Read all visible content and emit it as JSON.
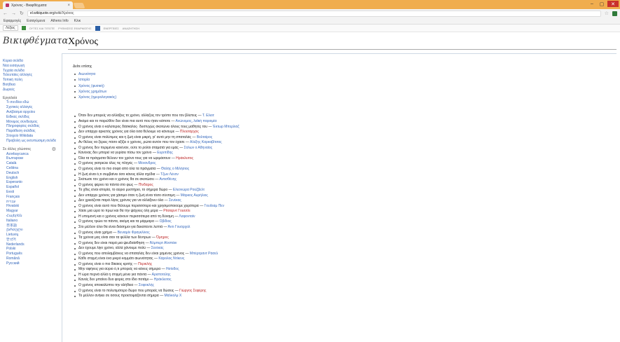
{
  "browser": {
    "tab_title": "Χρόνος - Βικιφθέγματα",
    "tab_close": "×",
    "win_min": "–",
    "win_max": "▢",
    "win_close": "✕",
    "url_host": "el.wikiquote.org",
    "url_path": "/wiki/Χρόνος",
    "bookmarks": [
      "Εφαρμογές",
      "Εισαγόμενα",
      "Athens Info",
      "Κλικ"
    ],
    "toolbar": {
      "button1": "Λέξεις",
      "label1": "ΟΥΤΕΣ ΚΑΙ ΤΙΠΟΤΕ",
      "label2": "ΡΥΘΜΙΣΕΙΣ ΕΦΑΡΜΟΓΗΣ",
      "label3": "ΕΝΕΡΓΕΙΕΣ",
      "label4": "ΑΝΑΖΗΤΗΣΗ"
    }
  },
  "wiki": {
    "logo": "Βικιφθέγματα",
    "page_title": "Χρόνος",
    "sidebar": {
      "nav": [
        "Κύρια σελίδα",
        "Νέα εισαγωγή",
        "Τυχαία σελίδα",
        "Τελευταίες αλλαγές",
        "Τοπική πύλη",
        "Βοήθεια",
        "Δωρεές"
      ],
      "tools_head": "Εργαλεία",
      "tools": [
        "Τι συνδέει εδώ",
        "Σχετικές αλλαγές",
        "Ανέβασμα αρχείου",
        "Ειδικές σελίδες",
        "Μόνιμος σύνδεσμος",
        "Πληροφορίες σελίδας",
        "Παράθεση σελίδας",
        "Στοιχείο Wikidata",
        "Προβολή ως εκτυπώσιμη σελίδα"
      ],
      "lang_head": "Σε άλλες γλώσσες",
      "languages": [
        "Azərbaycanca",
        "Български",
        "Català",
        "Čeština",
        "Deutsch",
        "English",
        "Esperanto",
        "Español",
        "Eesti",
        "Français",
        "עברית",
        "Hrvatski",
        "Magyar",
        "Հայերեն",
        "Italiano",
        "日本語",
        "ქართული",
        "Lietuvių",
        "한국어",
        "Nederlands",
        "Polski",
        "Português",
        "Română",
        "Русский"
      ]
    },
    "see_also": "Δείτε επίσης",
    "links": [
      "Αιωνιότητα",
      "Ιστορία",
      "Χρόνος (φυσική)",
      "Χρόνος χρημάτων",
      "Χρόνος (ημερολογιακός)"
    ],
    "quotes": [
      {
        "t": "Όταν δεν μπορείς να αλλάξεις το χρόνο, αλλάζεις τον τρόπο που τον βλέπεις — ",
        "a": "Τ. Ελιοτ"
      },
      {
        "t": "Ακόμα και το παρελθόν δεν είναι πια αυτό που ήταν κάποτε — ",
        "a": "Ανώνυμος, λαϊκή παροιμία"
      },
      {
        "t": "Ο χρόνος είναι ο καλύτερος δάσκαλος· δυστυχώς σκοτώνει όλους τους μαθητές του — ",
        "a": "Έκτωρ Μπερλιόζ"
      },
      {
        "t": "Δεν υπάρχει αρκετός χρόνος για όλα όσα θέλουμε να κάνουμε — ",
        "a": "Πλούταρχος"
      },
      {
        "t": "Ο χρόνος είναι πολύτιμος και η ζωή είναι μικρή, γι' αυτό μην τη σπαταλάς — ",
        "a": "Βολταίρος"
      },
      {
        "t": "Αν θέλεις να ξέρεις πόσο αξίζει ο χρόνος, ρώτα αυτόν που τον έχασε — ",
        "a": "Αλέξης Καρκαβίτσας"
      },
      {
        "t": "Ο χρόνος δεν περιμένει κανέναν, ούτε το ρολόι σταματά για εμάς — ",
        "a": "Σόλων ο Αθηναίος"
      },
      {
        "t": "Κανένας δεν μπορεί να γυρίσει πίσω τον χρόνο — ",
        "a": "Ευριπίδης"
      },
      {
        "t": "Όλα τα πράγματα θέλουν τον χρόνο τους για να ωριμάσουν — ",
        "a": "Ηράκλειτος"
      },
      {
        "t": "Ο χρόνος γιατρεύει όλες τις πληγές — ",
        "a": "Μένανδρος"
      },
      {
        "t": "Ο χρόνος είναι το πιο σοφό από όλα τα πράγματα — ",
        "a": "Θαλής ο Μιλήσιος"
      },
      {
        "t": "Η ζωή είναι ό,τι συμβαίνει όσο κάνεις άλλα σχέδια — ",
        "a": "Τζων Λένον"
      },
      {
        "t": "Σκότωσε τον χρόνο και ο χρόνος θα σε σκοτώσει — ",
        "a": "Αντισθένης"
      },
      {
        "t": "Ο χρόνος φέρνει τα πάντα στο φως — ",
        "a": "Πίνδαρος"
      },
      {
        "t": "Το χθες είναι ιστορία, το αύριο μυστήριο, το σήμερα δώρο — ",
        "a": "Ελεονώρα Ρούζβελτ"
      },
      {
        "t": "Δεν υπάρχει χρόνος για χάσιμο όταν η ζωή είναι τόσο σύντομη — ",
        "a": "Μάρκος Αυρήλιος"
      },
      {
        "t": "Δεν χρειάζεται παρά λίγος χρόνος για να αλλάξουν όλα — ",
        "a": "Σενέκας"
      },
      {
        "t": "Ο χρόνος είναι αυτό που θέλουμε περισσότερο και χρησιμοποιούμε χειρότερα — ",
        "a": "Γουίλιαμ Πεν"
      },
      {
        "t": "Χάσε μια ώρα το πρωί και θα την ψάχνεις όλη μέρα — ",
        "a": "Ρίτσαρντ Γουέιτλι"
      },
      {
        "t": "Η υπομονή και ο χρόνος κάνουν περισσότερα από τη δύναμη — ",
        "a": "Λαφονταίν"
      },
      {
        "t": "Ο χρόνος τρώει τα πάντα, ακόμη και τα μάρμαρα — ",
        "a": "Οβίδιος"
      },
      {
        "t": "Στο μέλλον όλοι θα είναι διάσημοι για δεκαπέντε λεπτά — ",
        "a": "Άντι Γουόρχολ"
      },
      {
        "t": "Ο χρόνος είναι χρήμα — ",
        "a": "Βενιαμίν Φραγκλίνος"
      },
      {
        "t": "Τα χρόνια μας είναι σαν τα φύλλα των δέντρων — ",
        "a": "Όμηρος"
      },
      {
        "t": "Ο χρόνος δεν είναι παρά μια ψευδαίσθηση — ",
        "a": "Άλμπερτ Αϊνστάιν"
      },
      {
        "t": "Δεν έχουμε λίγο χρόνο, αλλά χάνουμε πολύ — ",
        "a": "Σενέκας"
      },
      {
        "t": "Ο χρόνος που απολαμβάνεις να σπαταλάς δεν είναι χαμένος χρόνος — ",
        "a": "Μπέρτραντ Ράσελ"
      },
      {
        "t": "Κάθε στιγμή είναι ένα μικρό κομμάτι αιωνιότητας — ",
        "a": "Κάρολος Ντίκενς"
      },
      {
        "t": "Ο χρόνος είναι ο πιο δίκαιος κριτής — ",
        "a": "Περικλής"
      },
      {
        "t": "Μην αφήνεις για αύριο ό,τι μπορείς να κάνεις σήμερα — ",
        "a": "Ησίοδος"
      },
      {
        "t": "Η ώρα περνά αλλά η στιγμή μένει για πάντα — ",
        "a": "Αριστοτέλης"
      },
      {
        "t": "Κανείς δεν μπαίνει δυο φορές στο ίδιο ποτάμι — ",
        "a": "Ηράκλειτος"
      },
      {
        "t": "Ο χρόνος αποκαλύπτει την αλήθεια — ",
        "a": "Σοφοκλής"
      },
      {
        "t": "Ο χρόνος είναι το πολυτιμότερο δώρο που μπορείς να δώσεις — ",
        "a": "Γιώργος Σεφέρης"
      },
      {
        "t": "Το μέλλον ανήκει σε όσους προετοιμάζονται σήμερα — ",
        "a": "Μάλκολμ Χ"
      }
    ]
  }
}
